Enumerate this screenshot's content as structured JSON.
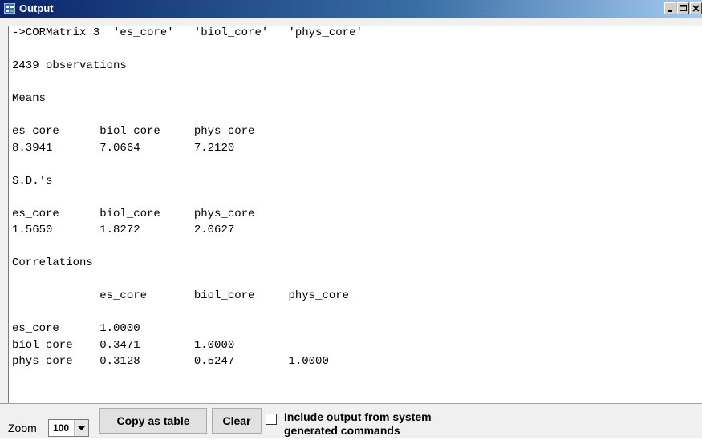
{
  "window": {
    "title": "Output"
  },
  "output": {
    "lines": [
      "->CORMatrix 3  'es_core'   'biol_core'   'phys_core'",
      "",
      "2439 observations",
      "",
      "Means",
      "",
      "es_core      biol_core     phys_core",
      "8.3941       7.0664        7.2120",
      "",
      "S.D.'s",
      "",
      "es_core      biol_core     phys_core",
      "1.5650       1.8272        2.0627",
      "",
      "Correlations",
      "",
      "             es_core       biol_core     phys_core",
      "",
      "es_core      1.0000",
      "biol_core    0.3471        1.0000",
      "phys_core    0.3128        0.5247        1.0000"
    ]
  },
  "bottom": {
    "zoom_label": "Zoom",
    "zoom_value": "100",
    "copy_label": "Copy as table",
    "clear_label": "Clear",
    "include_label_line1": "Include output from system",
    "include_label_line2": "generated commands",
    "include_checked": false
  },
  "colors": {
    "titlebar_start": "#0a246a",
    "titlebar_end": "#a6caf0"
  }
}
